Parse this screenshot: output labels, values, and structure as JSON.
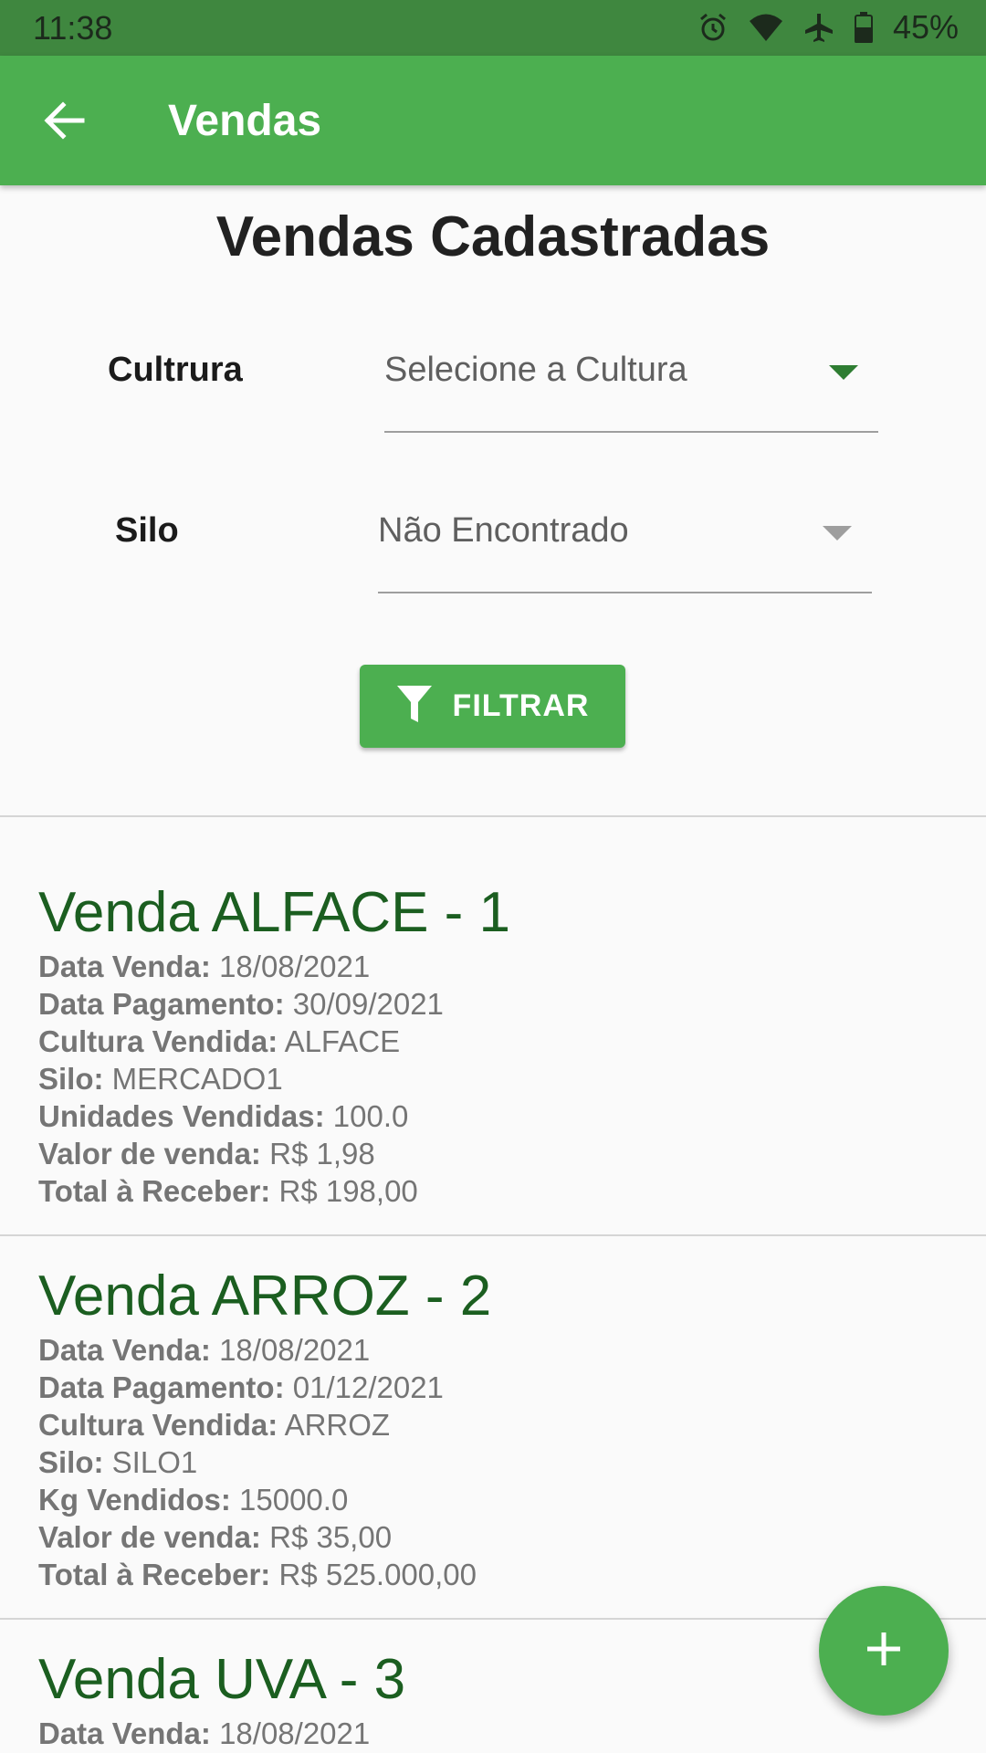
{
  "status_bar": {
    "time": "11:38",
    "battery_percent": "45%",
    "icons": [
      "alarm-icon",
      "wifi-icon",
      "airplane-icon",
      "battery-icon"
    ]
  },
  "app_bar": {
    "title": "Vendas",
    "back_icon": "arrow-left-icon",
    "color": "#4caf50"
  },
  "page_title": "Vendas Cadastradas",
  "filters": {
    "cultura": {
      "label": "Cultrura",
      "value": "Selecione a Cultura"
    },
    "silo": {
      "label": "Silo",
      "value": "Não Encontrado"
    },
    "filter_button": {
      "label": "FILTRAR",
      "icon": "filter-icon"
    }
  },
  "sales": [
    {
      "title": "Venda ALFACE - 1",
      "fields": [
        {
          "key": "Data Venda:",
          "value": "18/08/2021"
        },
        {
          "key": "Data Pagamento:",
          "value": "30/09/2021"
        },
        {
          "key": "Cultura Vendida:",
          "value": "ALFACE"
        },
        {
          "key": "Silo:",
          "value": "MERCADO1"
        },
        {
          "key": "Unidades Vendidas:",
          "value": "100.0"
        },
        {
          "key": "Valor de venda:",
          "value": "R$ 1,98"
        },
        {
          "key": "Total à Receber:",
          "value": "R$ 198,00"
        }
      ]
    },
    {
      "title": "Venda ARROZ - 2",
      "fields": [
        {
          "key": "Data Venda:",
          "value": "18/08/2021"
        },
        {
          "key": "Data Pagamento:",
          "value": "01/12/2021"
        },
        {
          "key": "Cultura Vendida:",
          "value": "ARROZ"
        },
        {
          "key": "Silo:",
          "value": "SILO1"
        },
        {
          "key": "Kg Vendidos:",
          "value": "15000.0"
        },
        {
          "key": "Valor de venda:",
          "value": "R$ 35,00"
        },
        {
          "key": "Total à Receber:",
          "value": "R$ 525.000,00"
        }
      ]
    },
    {
      "title": "Venda UVA - 3",
      "fields": [
        {
          "key": "Data Venda:",
          "value": "18/08/2021"
        }
      ]
    }
  ],
  "fab": {
    "icon": "plus-icon"
  },
  "colors": {
    "primary": "#4caf50",
    "status_bar": "#3f873f",
    "sale_title": "#1b5e20"
  }
}
